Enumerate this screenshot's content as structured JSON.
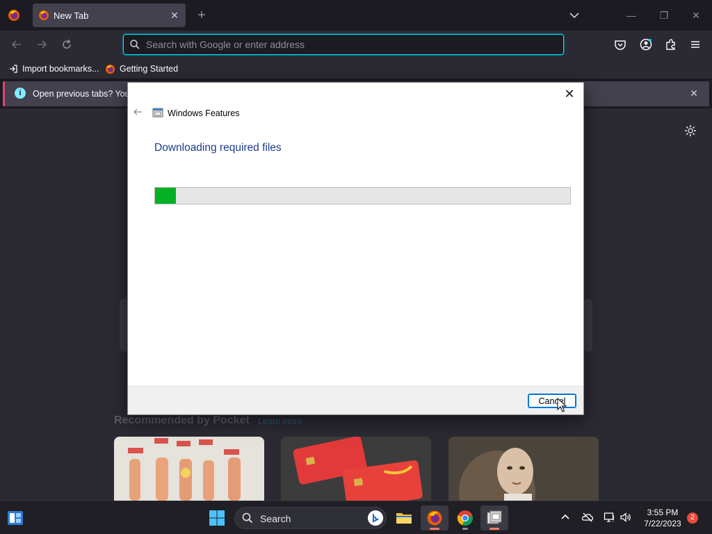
{
  "browser": {
    "tab_title": "New Tab",
    "tab_close_glyph": "✕",
    "new_tab_glyph": "+",
    "window_controls": {
      "minimize": "—",
      "restore": "❐",
      "close": "✕"
    },
    "address_placeholder": "Search with Google or enter address",
    "bookmarks": [
      {
        "label": "Import bookmarks...",
        "icon": "import-icon"
      },
      {
        "label": "Getting Started",
        "icon": "firefox-icon"
      }
    ],
    "notification": {
      "text": "Open previous tabs? You c",
      "close_glyph": "✕",
      "info_glyph": "i"
    }
  },
  "newtab": {
    "pocket_heading": "Recommended by Pocket",
    "pocket_learn_more": "Learn more"
  },
  "dialog": {
    "app_title": "Windows Features",
    "heading": "Downloading required files",
    "progress_percent": 5,
    "cancel_label": "Cancel",
    "close_glyph": "✕"
  },
  "taskbar": {
    "search_label": "Search",
    "time": "3:55 PM",
    "date": "7/22/2023",
    "notification_count": "2"
  },
  "colors": {
    "accent_focus": "#00ddff",
    "progress_green": "#06b025",
    "dialog_heading": "#1c3b8c",
    "notification_badge": "#e74c3c"
  }
}
